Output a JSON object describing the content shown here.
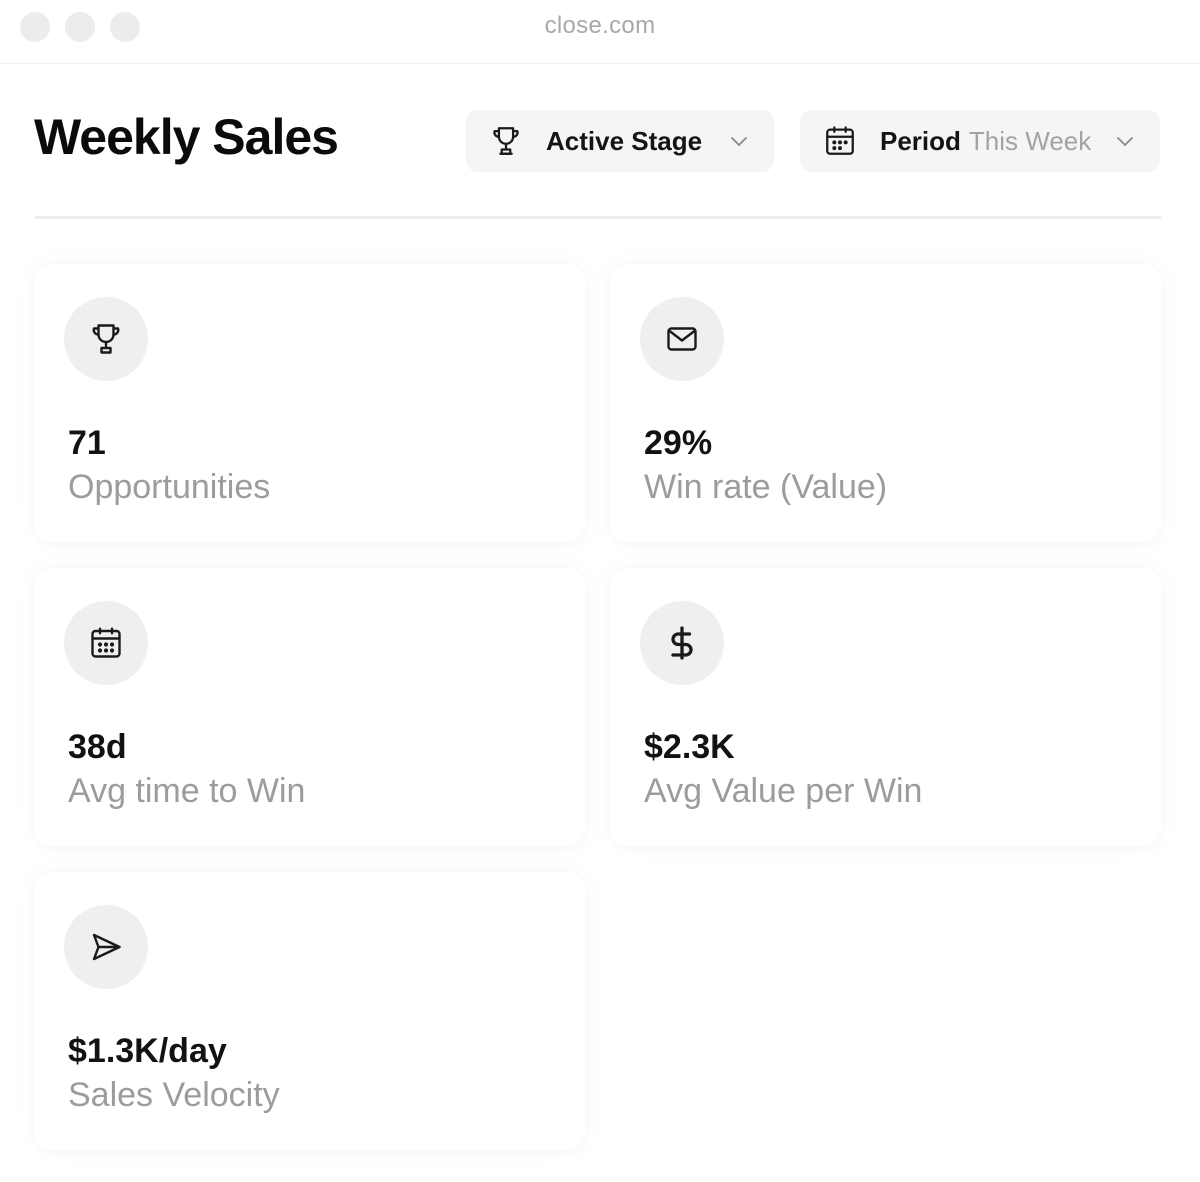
{
  "window": {
    "url": "close.com"
  },
  "header": {
    "title": "Weekly Sales",
    "stage_filter": {
      "label": "Active Stage",
      "icon": "trophy-icon"
    },
    "period_filter": {
      "label": "Period",
      "value": "This Week",
      "icon": "calendar-icon"
    }
  },
  "metrics": [
    {
      "icon": "trophy-icon",
      "value": "71",
      "label": "Opportunities"
    },
    {
      "icon": "envelope-icon",
      "value": "29%",
      "label": "Win rate (Value)"
    },
    {
      "icon": "calendar-icon",
      "value": "38d",
      "label": "Avg time to Win"
    },
    {
      "icon": "dollar-icon",
      "value": "$2.3K",
      "label": "Avg Value per Win"
    },
    {
      "icon": "send-icon",
      "value": "$1.3K/day",
      "label": "Sales Velocity"
    }
  ],
  "colors": {
    "badge_bg": "#efefef",
    "filter_bg": "#f5f5f5",
    "muted_text": "#9c9c9c"
  }
}
